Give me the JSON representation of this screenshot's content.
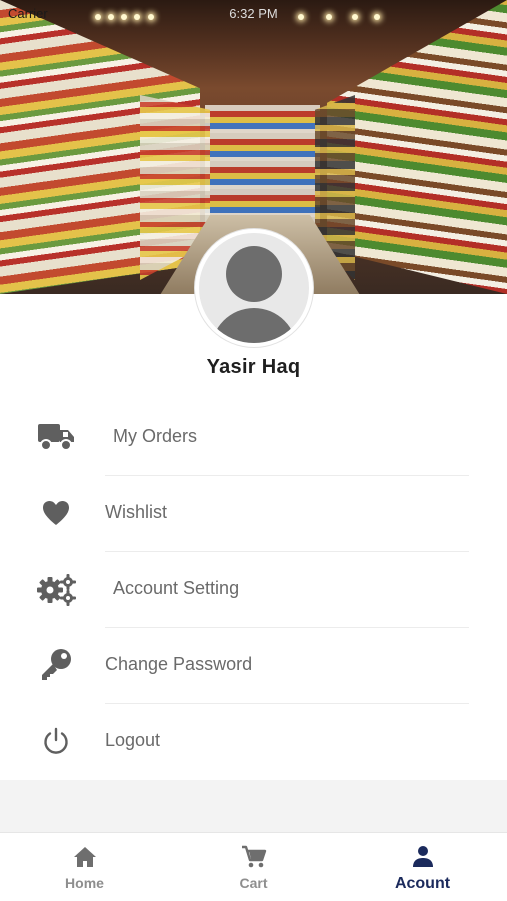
{
  "status_bar": {
    "carrier": "Carrier",
    "time": "6:32 PM"
  },
  "profile": {
    "name": "Yasir Haq"
  },
  "menu": [
    {
      "label": "My Orders",
      "icon": "truck-icon"
    },
    {
      "label": "Wishlist",
      "icon": "heart-icon"
    },
    {
      "label": "Account Setting",
      "icon": "gears-icon"
    },
    {
      "label": "Change Password",
      "icon": "key-icon"
    },
    {
      "label": "Logout",
      "icon": "power-icon"
    }
  ],
  "tabs": [
    {
      "label": "Home",
      "icon": "home-icon",
      "active": false
    },
    {
      "label": "Cart",
      "icon": "cart-icon",
      "active": false
    },
    {
      "label": "Acount",
      "icon": "user-icon",
      "active": true
    }
  ],
  "colors": {
    "active_tab": "#1b2a5c",
    "inactive_tab": "#8e8e8e",
    "icon_gray": "#5f5f5f",
    "label_gray": "#6a6a6a"
  }
}
